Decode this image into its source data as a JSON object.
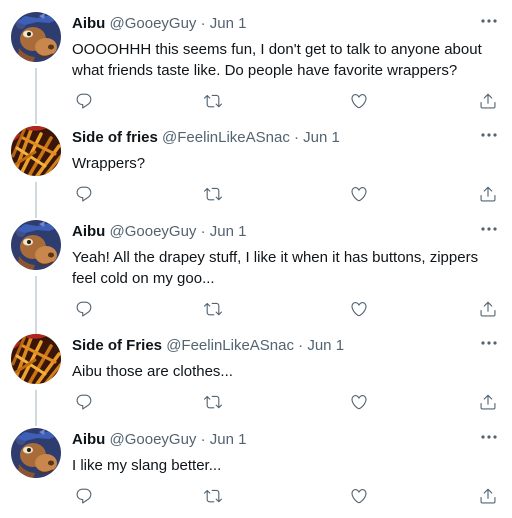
{
  "tweets": [
    {
      "avatar": "cartoon-moose-avatar",
      "name": "Aibu",
      "handle": "@GooeyGuy",
      "separator": "·",
      "date": "Jun 1",
      "lines": [
        "OOOOHHH this seems fun, I don't get to talk to anyone about",
        "what friends taste like. Do people have favorite wrappers?"
      ]
    },
    {
      "avatar": "french-fries-avatar",
      "name": "Side of fries",
      "handle": "@FeelinLikeASnac",
      "separator": "·",
      "date": "Jun 1",
      "lines": [
        "Wrappers?"
      ]
    },
    {
      "avatar": "cartoon-moose-avatar",
      "name": "Aibu",
      "handle": "@GooeyGuy",
      "separator": "·",
      "date": "Jun 1",
      "lines": [
        "Yeah! All the drapey stuff, I like it when it has buttons, zippers",
        "feel cold on my goo..."
      ]
    },
    {
      "avatar": "french-fries-avatar",
      "name": "Side of Fries",
      "handle": "@FeelinLikeASnac",
      "separator": "·",
      "date": "Jun 1",
      "lines": [
        "Aibu those are clothes..."
      ]
    },
    {
      "avatar": "cartoon-moose-avatar",
      "name": "Aibu",
      "handle": "@GooeyGuy",
      "separator": "·",
      "date": "Jun 1",
      "lines": [
        "I like my slang better..."
      ]
    }
  ],
  "icons": {
    "more": "more-options-icon",
    "reply": "reply-icon",
    "retweet": "retweet-icon",
    "like": "like-icon",
    "share": "share-icon"
  },
  "colors": {
    "text": "#0f1419",
    "secondary": "#536471",
    "thread_line": "#cfd9de"
  }
}
